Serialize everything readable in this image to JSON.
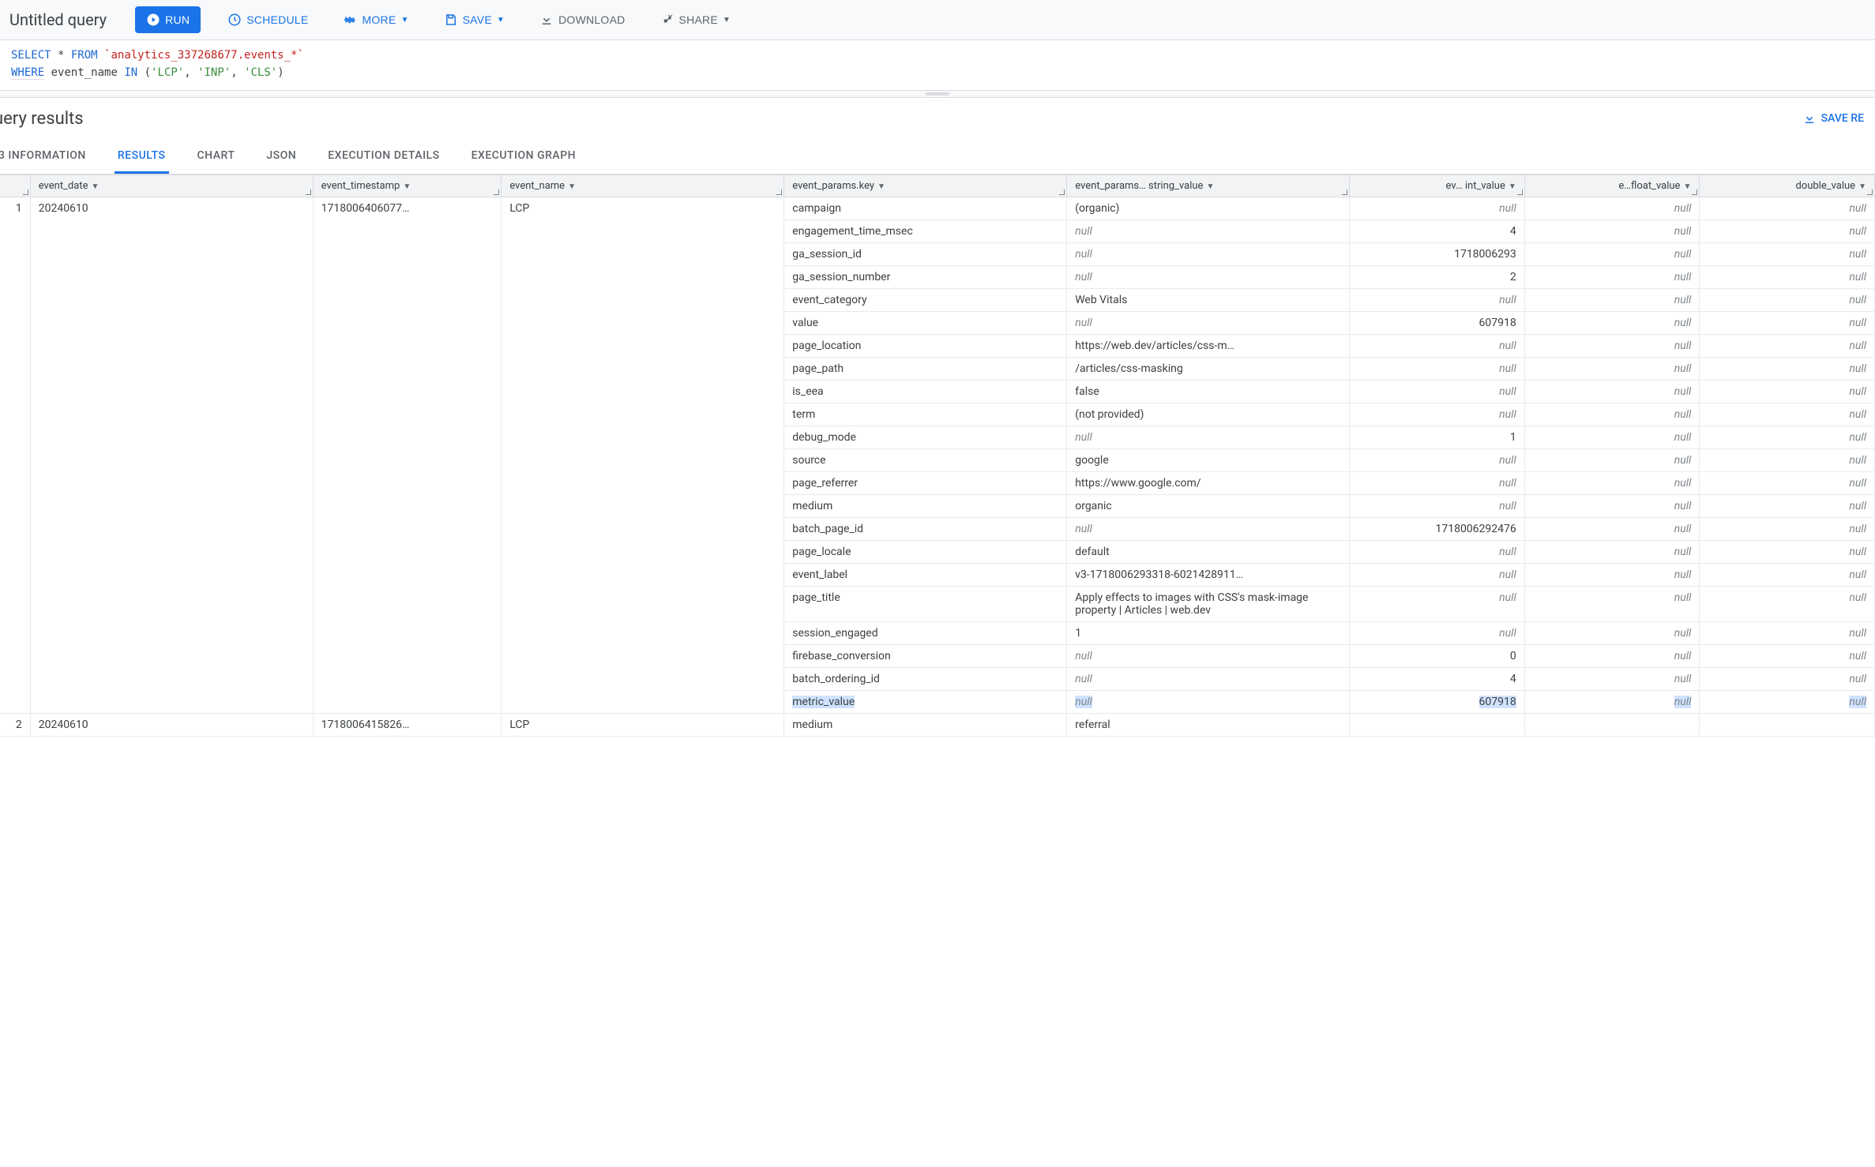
{
  "header": {
    "title": "Untitled query",
    "run": "RUN",
    "schedule": "SCHEDULE",
    "more": "MORE",
    "save": "SAVE",
    "download": "DOWNLOAD",
    "share": "SHARE"
  },
  "sql": {
    "line1_select": "SELECT",
    "line1_star": " * ",
    "line1_from": "FROM ",
    "line1_table": "`analytics_337268677.events_*`",
    "line2_where": "WHERE",
    "line2_col": " event_name ",
    "line2_in": "IN ",
    "line2_paren_open": "(",
    "line2_v1": "'LCP'",
    "line2_c1": ", ",
    "line2_v2": "'INP'",
    "line2_c2": ", ",
    "line2_v3": "'CLS'",
    "line2_paren_close": ")"
  },
  "results": {
    "title": "uery results",
    "save_results": "SAVE RE"
  },
  "tabs": {
    "job_info": "3 INFORMATION",
    "results": "RESULTS",
    "chart": "CHART",
    "json": "JSON",
    "exec_details": "EXECUTION DETAILS",
    "exec_graph": "EXECUTION GRAPH"
  },
  "columns": {
    "row": "",
    "event_date": "event_date",
    "event_timestamp": "event_timestamp",
    "event_name": "event_name",
    "key": "event_params.key",
    "string_value": "event_params… string_value",
    "int_value": "ev… int_value",
    "float_value": "e…float_value",
    "double_value": "double_value"
  },
  "rows": [
    {
      "n": "1",
      "event_date": "20240610",
      "event_timestamp": "1718006406077…",
      "event_name": "LCP",
      "params": [
        {
          "key": "campaign",
          "s": "(organic)",
          "i": null,
          "f": null,
          "d": null
        },
        {
          "key": "engagement_time_msec",
          "s": null,
          "i": "4",
          "f": null,
          "d": null
        },
        {
          "key": "ga_session_id",
          "s": null,
          "i": "1718006293",
          "f": null,
          "d": null
        },
        {
          "key": "ga_session_number",
          "s": null,
          "i": "2",
          "f": null,
          "d": null
        },
        {
          "key": "event_category",
          "s": "Web Vitals",
          "i": null,
          "f": null,
          "d": null
        },
        {
          "key": "value",
          "s": null,
          "i": "607918",
          "f": null,
          "d": null
        },
        {
          "key": "page_location",
          "s": "https://web.dev/articles/css-m…",
          "i": null,
          "f": null,
          "d": null
        },
        {
          "key": "page_path",
          "s": "/articles/css-masking",
          "i": null,
          "f": null,
          "d": null
        },
        {
          "key": "is_eea",
          "s": "false",
          "i": null,
          "f": null,
          "d": null
        },
        {
          "key": "term",
          "s": "(not provided)",
          "i": null,
          "f": null,
          "d": null
        },
        {
          "key": "debug_mode",
          "s": null,
          "i": "1",
          "f": null,
          "d": null
        },
        {
          "key": "source",
          "s": "google",
          "i": null,
          "f": null,
          "d": null
        },
        {
          "key": "page_referrer",
          "s": "https://www.google.com/",
          "i": null,
          "f": null,
          "d": null
        },
        {
          "key": "medium",
          "s": "organic",
          "i": null,
          "f": null,
          "d": null
        },
        {
          "key": "batch_page_id",
          "s": null,
          "i": "1718006292476",
          "f": null,
          "d": null
        },
        {
          "key": "page_locale",
          "s": "default",
          "i": null,
          "f": null,
          "d": null
        },
        {
          "key": "event_label",
          "s": "v3-1718006293318-6021428911…",
          "i": null,
          "f": null,
          "d": null
        },
        {
          "key": "page_title",
          "s": "Apply effects to images with CSS's mask-image property  |  Articles  |  web.dev",
          "i": null,
          "f": null,
          "d": null,
          "wrap": true
        },
        {
          "key": "session_engaged",
          "s": "1",
          "i": null,
          "f": null,
          "d": null
        },
        {
          "key": "firebase_conversion",
          "s": null,
          "i": "0",
          "f": null,
          "d": null
        },
        {
          "key": "batch_ordering_id",
          "s": null,
          "i": "4",
          "f": null,
          "d": null
        },
        {
          "key": "metric_value",
          "s": null,
          "i": "607918",
          "f": null,
          "d": null,
          "hl": true
        }
      ]
    },
    {
      "n": "2",
      "event_date": "20240610",
      "event_timestamp": "1718006415826…",
      "event_name": "LCP",
      "params": [
        {
          "key": "medium",
          "s": "referral",
          "i": "",
          "f": "",
          "d": ""
        }
      ]
    }
  ],
  "null_label": "null"
}
